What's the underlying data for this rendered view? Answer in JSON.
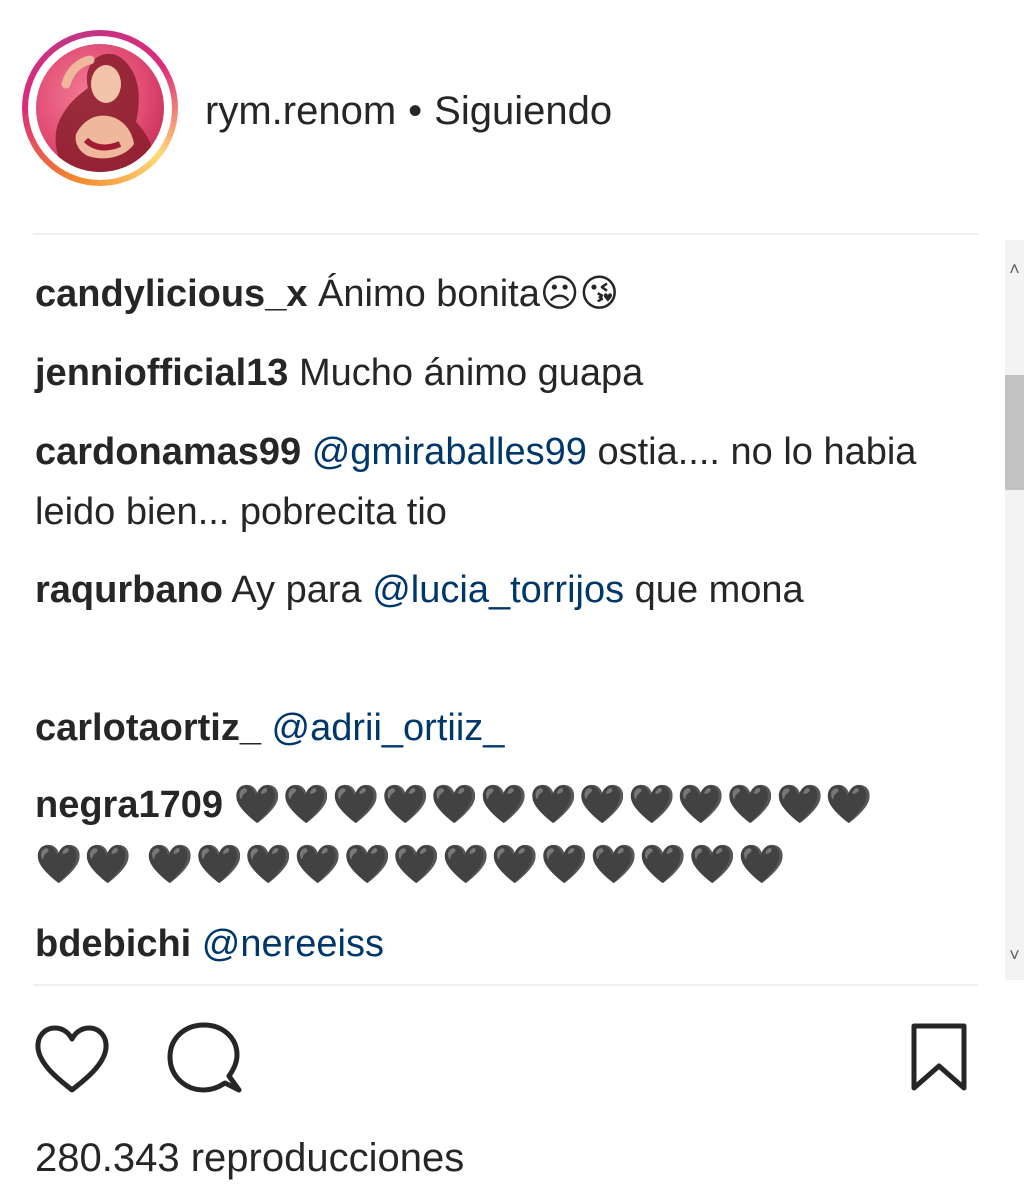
{
  "header": {
    "username": "rym.renom",
    "separator": "•",
    "follow_status": "Siguiendo"
  },
  "comments": [
    {
      "username": "candylicious_x",
      "text": "Ánimo bonita☹😘"
    },
    {
      "username": "jenniofficial13",
      "text": "Mucho ánimo guapa"
    },
    {
      "username": "cardonamas99",
      "mention": "@gmiraballes99",
      "text": "ostia.... no lo habia leido bien... pobrecita tio"
    },
    {
      "username": "raqurbano",
      "text_before": "Ay para",
      "mention": "@lucia_torrijos",
      "text_after": "que mona"
    },
    {
      "username": "carlotaortiz_",
      "mention": "@adrii_ortiiz_"
    },
    {
      "username": "negra1709",
      "text": "🖤🖤🖤🖤🖤🖤🖤🖤🖤🖤🖤🖤🖤🖤🖤 🖤🖤🖤🖤🖤🖤🖤🖤🖤🖤🖤🖤🖤"
    },
    {
      "username": "bdebichi",
      "mention": "@nereeiss"
    }
  ],
  "actions": {
    "like_icon": "heart-outline-icon",
    "comment_icon": "speech-bubble-icon",
    "save_icon": "bookmark-icon"
  },
  "stats": {
    "views": "280.343 reproducciones"
  },
  "colors": {
    "text": "#262626",
    "mention": "#00376b",
    "divider": "#efefef"
  }
}
